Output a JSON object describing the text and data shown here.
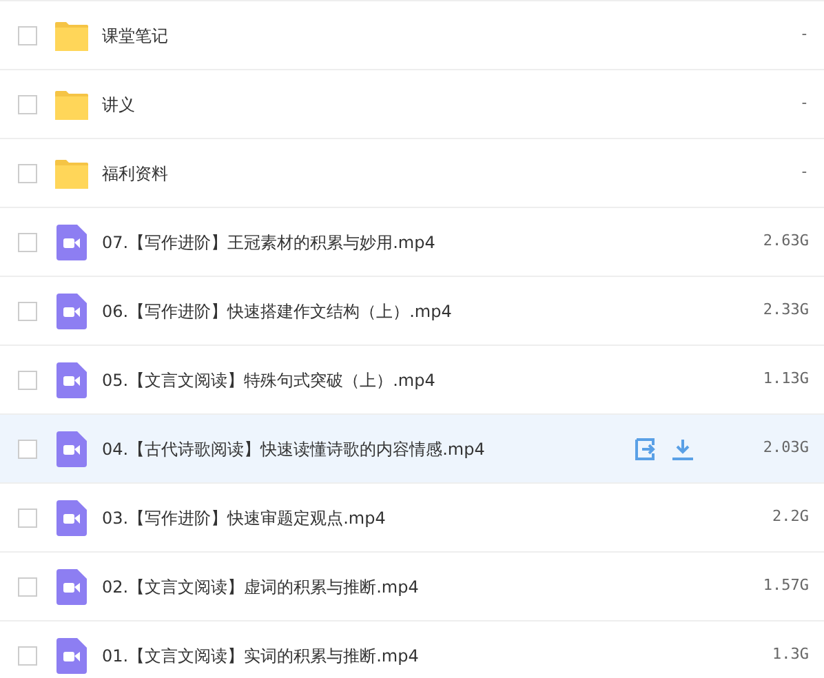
{
  "files": [
    {
      "kind": "folder",
      "name": "课堂笔记",
      "size": "-",
      "checked": false,
      "hovered": false
    },
    {
      "kind": "folder",
      "name": "讲义",
      "size": "-",
      "checked": false,
      "hovered": false
    },
    {
      "kind": "folder",
      "name": "福利资料",
      "size": "-",
      "checked": false,
      "hovered": false
    },
    {
      "kind": "video",
      "name": "07.【写作进阶】王冠素材的积累与妙用.mp4",
      "size": "2.63G",
      "checked": false,
      "hovered": false
    },
    {
      "kind": "video",
      "name": "06.【写作进阶】快速搭建作文结构（上）.mp4",
      "size": "2.33G",
      "checked": false,
      "hovered": false
    },
    {
      "kind": "video",
      "name": "05.【文言文阅读】特殊句式突破（上）.mp4",
      "size": "1.13G",
      "checked": false,
      "hovered": false
    },
    {
      "kind": "video",
      "name": "04.【古代诗歌阅读】快速读懂诗歌的内容情感.mp4",
      "size": "2.03G",
      "checked": false,
      "hovered": true
    },
    {
      "kind": "video",
      "name": "03.【写作进阶】快速审题定观点.mp4",
      "size": "2.2G",
      "checked": false,
      "hovered": false
    },
    {
      "kind": "video",
      "name": "02.【文言文阅读】虚词的积累与推断.mp4",
      "size": "1.57G",
      "checked": false,
      "hovered": false
    },
    {
      "kind": "video",
      "name": "01.【文言文阅读】实词的积累与推断.mp4",
      "size": "1.3G",
      "checked": false,
      "hovered": false
    }
  ]
}
